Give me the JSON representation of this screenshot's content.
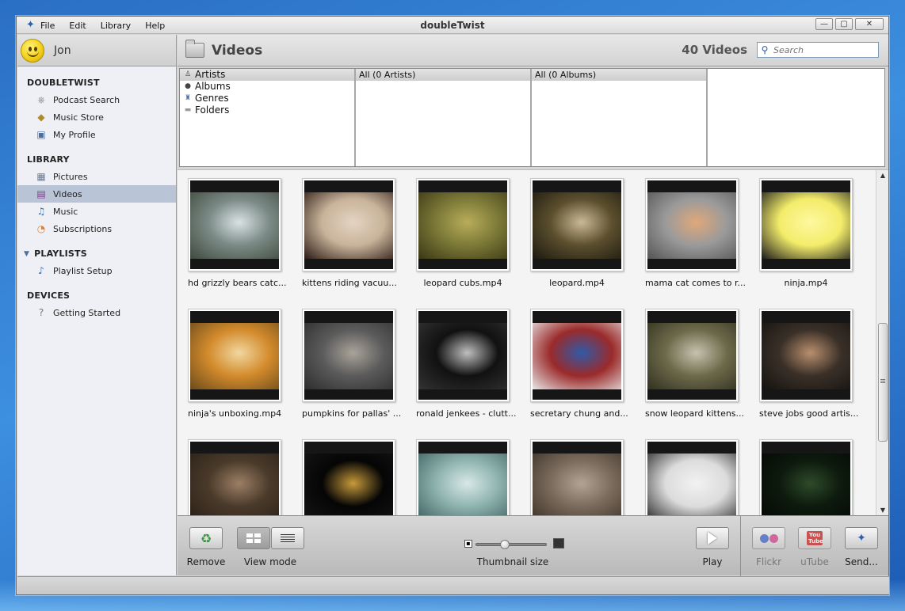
{
  "window": {
    "title": "doubleTwist",
    "menu": [
      "File",
      "Edit",
      "Library",
      "Help"
    ],
    "controls": {
      "minimize": "—",
      "maximize": "▢",
      "close": "✕"
    }
  },
  "user": {
    "name": "Jon"
  },
  "sidebar": {
    "sections": [
      {
        "title": "DOUBLETWIST",
        "items": [
          {
            "label": "Podcast Search",
            "icon": "podcast-search-icon"
          },
          {
            "label": "Music Store",
            "icon": "music-store-icon"
          },
          {
            "label": "My Profile",
            "icon": "profile-icon"
          }
        ]
      },
      {
        "title": "LIBRARY",
        "items": [
          {
            "label": "Pictures",
            "icon": "pictures-icon"
          },
          {
            "label": "Videos",
            "icon": "videos-icon",
            "active": true
          },
          {
            "label": "Music",
            "icon": "music-icon"
          },
          {
            "label": "Subscriptions",
            "icon": "rss-icon"
          }
        ]
      },
      {
        "title": "PLAYLISTS",
        "items": [
          {
            "label": "Playlist Setup",
            "icon": "playlist-icon"
          }
        ]
      },
      {
        "title": "DEVICES",
        "items": [
          {
            "label": "Getting Started",
            "icon": "help-icon"
          }
        ]
      }
    ]
  },
  "main": {
    "title": "Videos",
    "count": "40 Videos",
    "search_placeholder": "Search"
  },
  "browser": {
    "categories": [
      "Artists",
      "Albums",
      "Genres",
      "Folders"
    ],
    "artists_header": "All (0 Artists)",
    "albums_header": "All (0 Albums)"
  },
  "videos": [
    {
      "caption": "hd grizzly bears catc...",
      "palette": [
        "#7b8a86",
        "#d9e2e4",
        "#3f4a3e"
      ]
    },
    {
      "caption": "kittens riding vacuu...",
      "palette": [
        "#c9b39a",
        "#e3d4c2",
        "#2a1a14"
      ]
    },
    {
      "caption": "leopard cubs.mp4",
      "palette": [
        "#7d7a38",
        "#b8ad5a",
        "#3a3615"
      ]
    },
    {
      "caption": "leopard.mp4",
      "palette": [
        "#5b4f2d",
        "#cbb996",
        "#1c1810"
      ]
    },
    {
      "caption": "mama cat comes to r...",
      "palette": [
        "#9a9a9a",
        "#e0a87a",
        "#555555"
      ]
    },
    {
      "caption": "ninja.mp4",
      "palette": [
        "#f3ec6a",
        "#fff8a0",
        "#1a1a1a"
      ]
    },
    {
      "caption": "ninja's unboxing.mp4",
      "palette": [
        "#d38b2c",
        "#f1d7a0",
        "#6b4a1c"
      ]
    },
    {
      "caption": "pumpkins for pallas' ...",
      "palette": [
        "#5b5b5b",
        "#a9a39a",
        "#2d2d2d"
      ]
    },
    {
      "caption": "ronald jenkees - clutt...",
      "palette": [
        "#111111",
        "#bfbfbf",
        "#333333"
      ]
    },
    {
      "caption": "secretary chung and...",
      "palette": [
        "#9b2a2a",
        "#2f5aa8",
        "#e8e8e8"
      ]
    },
    {
      "caption": "snow leopard kittens...",
      "palette": [
        "#6d6a4b",
        "#c6c2ae",
        "#30301e"
      ]
    },
    {
      "caption": "steve jobs good artis...",
      "palette": [
        "#3a3028",
        "#b98f6e",
        "#151210"
      ]
    },
    {
      "caption": "",
      "palette": [
        "#4a3a2a",
        "#9c7f66",
        "#2a2018"
      ]
    },
    {
      "caption": "",
      "palette": [
        "#050505",
        "#c79a3a",
        "#151515"
      ]
    },
    {
      "caption": "",
      "palette": [
        "#8fb4b0",
        "#d8e8e6",
        "#3e6260"
      ]
    },
    {
      "caption": "",
      "palette": [
        "#7b6b5c",
        "#b3a393",
        "#3d332a"
      ]
    },
    {
      "caption": "",
      "palette": [
        "#dcdcdc",
        "#f2f2f2",
        "#2a2a2a"
      ]
    },
    {
      "caption": "",
      "palette": [
        "#0d1a0d",
        "#2f4a2a",
        "#050805"
      ]
    }
  ],
  "toolbar": {
    "remove": "Remove",
    "view_mode": "View mode",
    "thumbnail_size": "Thumbnail size",
    "thumbnail_size_value": 0.4,
    "play": "Play",
    "flickr": "Flickr",
    "youtube": "uTube",
    "youtube_badge": "You Tube",
    "send": "Send..."
  }
}
